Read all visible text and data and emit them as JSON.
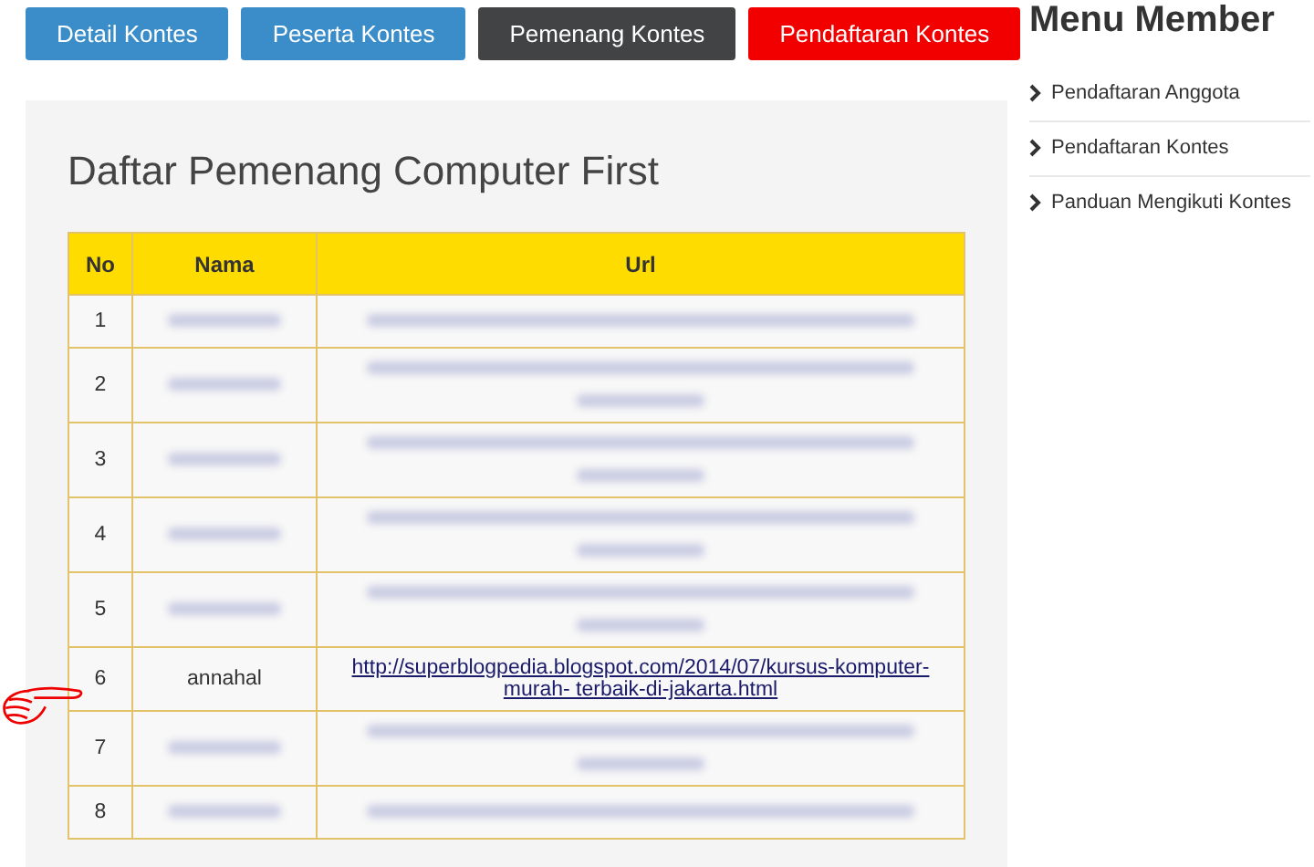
{
  "nav_buttons": [
    {
      "label": "Detail Kontes",
      "kind": "primary"
    },
    {
      "label": "Peserta Kontes",
      "kind": "primary"
    },
    {
      "label": "Pemenang Kontes",
      "kind": "dark"
    },
    {
      "label": "Pendaftaran Kontes",
      "kind": "danger"
    }
  ],
  "content": {
    "title": "Daftar Pemenang Computer First",
    "table": {
      "columns": [
        "No",
        "Nama",
        "Url"
      ],
      "rows": [
        {
          "no": "1",
          "kind": "blurred-short"
        },
        {
          "no": "2",
          "kind": "blurred"
        },
        {
          "no": "3",
          "kind": "blurred"
        },
        {
          "no": "4",
          "kind": "blurred"
        },
        {
          "no": "5",
          "kind": "blurred"
        },
        {
          "no": "6",
          "kind": "text",
          "nama": "annahal",
          "url": "http://superblogpedia.blogspot.com/2014/07/kursus-komputer-murah- terbaik-di-jakarta.html"
        },
        {
          "no": "7",
          "kind": "blurred"
        },
        {
          "no": "8",
          "kind": "blurred-short"
        }
      ]
    }
  },
  "sidebar": {
    "title": "Menu Member",
    "items": [
      "Pendaftaran Anggota",
      "Pendaftaran Kontes",
      "Panduan Mengikuti Kontes"
    ]
  }
}
